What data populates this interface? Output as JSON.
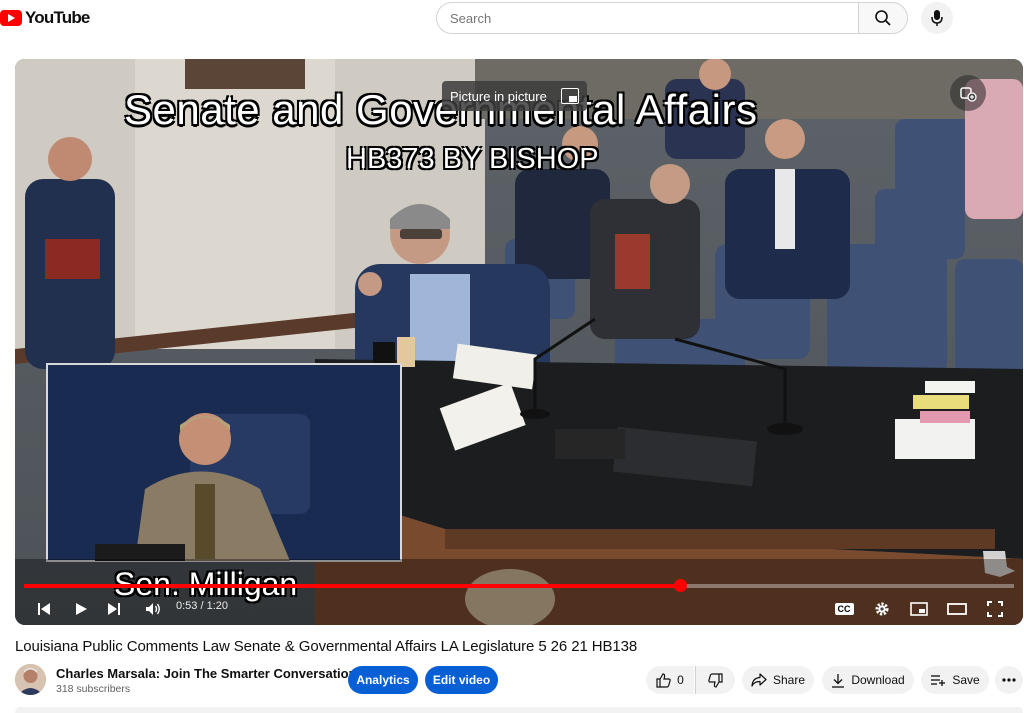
{
  "brand": {
    "name": "YouTube"
  },
  "search": {
    "placeholder": "Search"
  },
  "player": {
    "pip_label": "Picture in picture",
    "overlay_title": "Senate and Governmental Affairs",
    "overlay_subtitle": "HB373 BY BISHOP",
    "overlay_name": "Sen. Milligan",
    "time": "0:53 / 1:20",
    "progress_fraction": 0.6625,
    "captions_label": "CC"
  },
  "video": {
    "title": "Louisiana Public Comments Law Senate & Governmental Affairs LA Legislature 5 26 21 HB138"
  },
  "channel": {
    "name": "Charles Marsala: Join The Smarter Conversation",
    "subscribers": "318 subscribers"
  },
  "actions": {
    "analytics": "Analytics",
    "edit_video": "Edit video",
    "like_count": "0",
    "share": "Share",
    "download": "Download",
    "save": "Save"
  },
  "colors": {
    "brand_red": "#ff0000",
    "primary_blue": "#065fd4",
    "pill_grey": "#f2f2f2"
  }
}
